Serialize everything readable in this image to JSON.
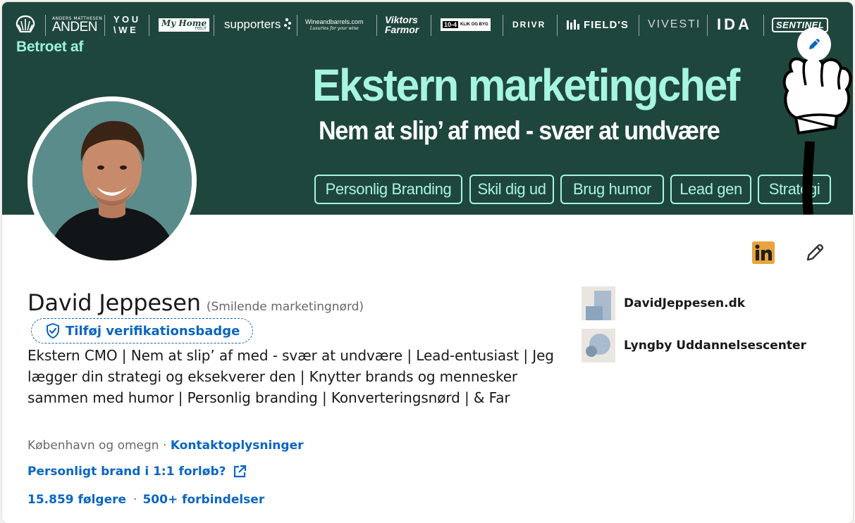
{
  "banner": {
    "logos": [
      {
        "name": "shell",
        "text": ""
      },
      {
        "name": "anden",
        "text": "ANDEN",
        "small": "ANDERS MATTHESEN"
      },
      {
        "name": "you-we",
        "text": "Y O U",
        "text2": "\\ W E"
      },
      {
        "name": "my-home",
        "text": "My Home",
        "small": "FEELIT"
      },
      {
        "name": "supporters",
        "text": "supporters"
      },
      {
        "name": "wineandbarrels",
        "text": "Wineandbarrels.com",
        "small": "Luxuries for your wine"
      },
      {
        "name": "viktors-farmor",
        "text": "Viktors",
        "text2": "Farmor"
      },
      {
        "name": "10-4",
        "text": "10-4",
        "small": "KLIK OG BYG"
      },
      {
        "name": "drivr",
        "text": "DRIVR"
      },
      {
        "name": "fields",
        "text": "FIELD'S"
      },
      {
        "name": "vivesti",
        "text": "VIVESTI"
      },
      {
        "name": "ida",
        "text": "IDA"
      },
      {
        "name": "sentinel",
        "text": "SENTINEL"
      }
    ],
    "trusted_by": "Betroet af",
    "headline": "Ekstern marketingchef",
    "subline": "Nem at slip’ af med - svær at undvære",
    "chips": [
      "Personlig Branding",
      "Skil dig ud",
      "Brug humor",
      "Lead gen",
      "Strategi"
    ]
  },
  "profile": {
    "name": "David Jeppesen",
    "pronouns": "(Smilende marketingnørd)",
    "verify_label": "Tilføj verifikationsbadge",
    "headline": "Ekstern CMO | Nem at slip’ af med - svær at undvære | Lead-entusiast | Jeg lægger din strategi og eksekverer den | Knytter brands og mennesker sammen med humor | Personlig branding | Konverteringsnørd | & Far",
    "location": "København og omegn",
    "separator": " · ",
    "contact_link": "Kontaktoplysninger",
    "brand_link": "Personligt brand i 1:1 forløb?",
    "followers": "15.859 følgere",
    "stats_separator": "·",
    "connections": "500+ forbindelser"
  },
  "right": {
    "company": "DavidJeppesen.dk",
    "school": "Lyngby Uddannelsescenter"
  },
  "colors": {
    "banner_bg": "#1f463c",
    "mint": "#a6f5df",
    "link": "#0a66c2",
    "linkedin_orange": "#e7a33e"
  },
  "icons": [
    "edit-pencil-icon",
    "linkedin-icon",
    "shield-check-icon",
    "external-link-icon"
  ]
}
